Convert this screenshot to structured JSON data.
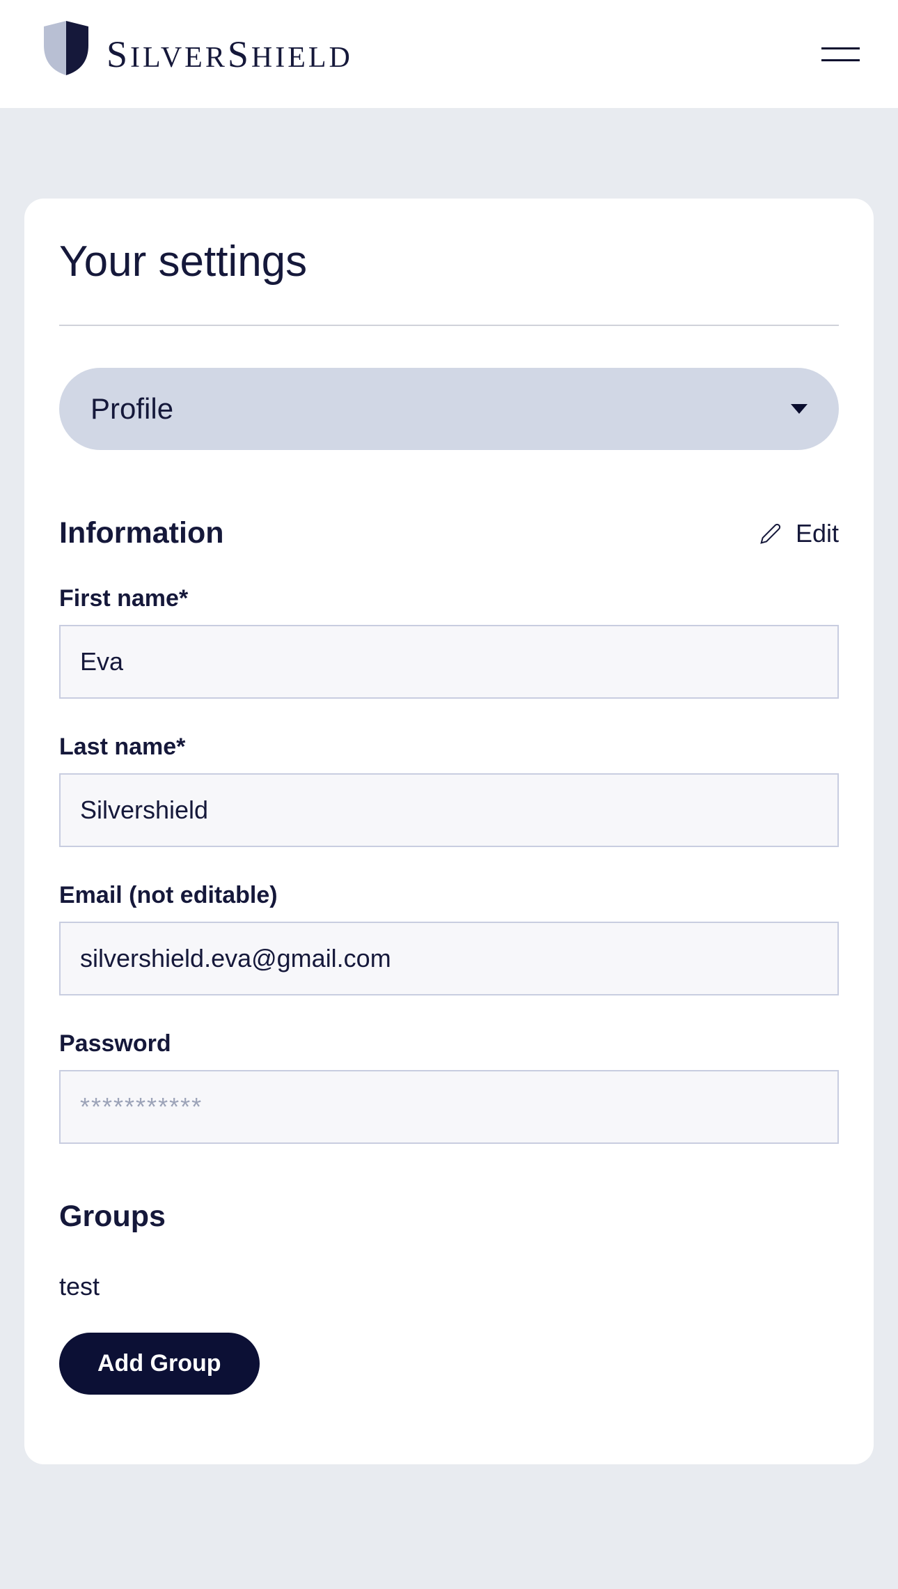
{
  "header": {
    "logo_text": "SilverShield"
  },
  "page": {
    "title": "Your settings"
  },
  "dropdown": {
    "selected": "Profile"
  },
  "information": {
    "title": "Information",
    "edit_label": "Edit",
    "fields": {
      "first_name": {
        "label": "First name*",
        "value": "Eva"
      },
      "last_name": {
        "label": "Last name*",
        "value": "Silvershield"
      },
      "email": {
        "label": "Email (not editable)",
        "value": "silvershield.eva@gmail.com"
      },
      "password": {
        "label": "Password",
        "placeholder": "***********"
      }
    }
  },
  "groups": {
    "title": "Groups",
    "items": [
      "test"
    ],
    "add_button_label": "Add Group"
  }
}
